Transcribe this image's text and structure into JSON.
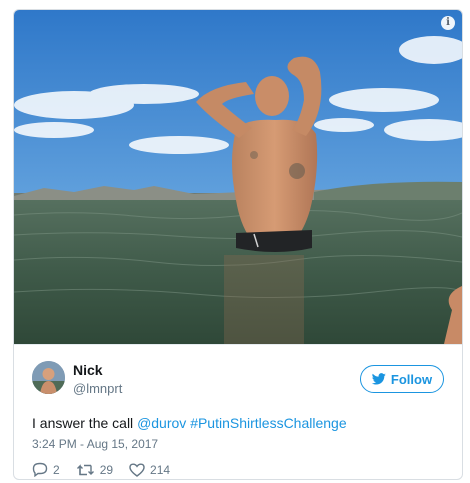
{
  "photo": {
    "alt": "",
    "info_icon": "i"
  },
  "author": {
    "name": "Nick",
    "handle": "@lmnprt",
    "avatar_icon": "avatar-photo"
  },
  "follow_button": {
    "label": "Follow",
    "icon": "twitter-bird-icon"
  },
  "tweet": {
    "text_prefix": "I answer the call ",
    "mention": "@durov",
    "hashtag": "#PutinShirtlessChallenge",
    "timestamp": "3:24 PM - Aug 15, 2017"
  },
  "actions": {
    "replies": "2",
    "retweets": "29",
    "likes": "214"
  },
  "colors": {
    "accent": "#1b95e0",
    "text": "#14171a",
    "muted": "#657786"
  }
}
